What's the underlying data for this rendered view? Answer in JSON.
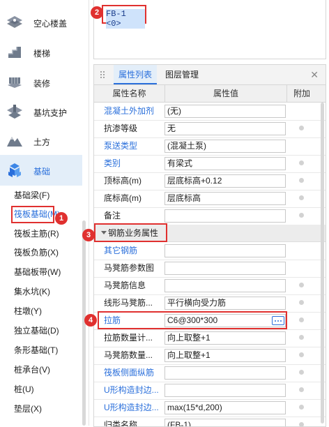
{
  "sidebar": {
    "categories": [
      {
        "label": "空心楼盖",
        "icon": "hollow-floor-icon"
      },
      {
        "label": "楼梯",
        "icon": "stairs-icon"
      },
      {
        "label": "装修",
        "icon": "decoration-icon"
      },
      {
        "label": "基坑支护",
        "icon": "pit-support-icon"
      },
      {
        "label": "土方",
        "icon": "earthwork-icon"
      },
      {
        "label": "基础",
        "icon": "foundation-icon",
        "active": true
      }
    ],
    "sub_items": [
      {
        "label": "基础梁(F)"
      },
      {
        "label": "筏板基础(M)",
        "selected": true
      },
      {
        "label": "筏板主筋(R)"
      },
      {
        "label": "筏板负筋(X)"
      },
      {
        "label": "基础板带(W)"
      },
      {
        "label": "集水坑(K)"
      },
      {
        "label": "柱墩(Y)"
      },
      {
        "label": "独立基础(D)"
      },
      {
        "label": "条形基础(T)"
      },
      {
        "label": "桩承台(V)"
      },
      {
        "label": "桩(U)"
      },
      {
        "label": "垫层(X)"
      }
    ]
  },
  "preview": {
    "code": "FB-1 <0>"
  },
  "panel": {
    "tabs": [
      {
        "label": "属性列表",
        "active": true
      },
      {
        "label": "图层管理"
      }
    ],
    "close_icon": "close-icon",
    "columns": {
      "name": "属性名称",
      "value": "属性值",
      "extra": "附加"
    },
    "rows_top": [
      {
        "name": "混凝土外加剂",
        "value": "(无)",
        "link": true,
        "dot": false
      },
      {
        "name": "抗渗等级",
        "value": "无",
        "link": false,
        "dot": true
      },
      {
        "name": "泵送类型",
        "value": "(混凝土泵)",
        "link": true,
        "dot": false
      },
      {
        "name": "类别",
        "value": "有梁式",
        "link": true,
        "dot": true
      },
      {
        "name": "顶标高(m)",
        "value": "层底标高+0.12",
        "link": false,
        "dot": true
      },
      {
        "name": "底标高(m)",
        "value": "层底标高",
        "link": false,
        "dot": true
      },
      {
        "name": "备注",
        "value": "",
        "link": false,
        "dot": true
      }
    ],
    "group": {
      "label": "钢筋业务属性"
    },
    "rows_bottom": [
      {
        "name": "其它钢筋",
        "value": "",
        "link": true,
        "dot": false
      },
      {
        "name": "马凳筋参数图",
        "value": "",
        "link": false,
        "dot": false
      },
      {
        "name": "马凳筋信息",
        "value": "",
        "link": false,
        "dot": true
      },
      {
        "name": "线形马凳筋...",
        "value": "平行横向受力筋",
        "link": false,
        "dot": true
      },
      {
        "name": "拉筋",
        "value": "C6@300*300",
        "link": true,
        "dot": true,
        "has_button": true
      },
      {
        "name": "拉筋数量计...",
        "value": "向上取整+1",
        "link": false,
        "dot": true
      },
      {
        "name": "马凳筋数量...",
        "value": "向上取整+1",
        "link": false,
        "dot": true
      },
      {
        "name": "筏板侧面纵筋",
        "value": "",
        "link": true,
        "dot": true
      },
      {
        "name": "U形构造封边...",
        "value": "",
        "link": true,
        "dot": true
      },
      {
        "name": "U形构造封边...",
        "value": "max(15*d,200)",
        "link": true,
        "dot": true
      },
      {
        "name": "归类名称",
        "value": "(FB-1)",
        "link": false,
        "dot": true
      }
    ]
  },
  "annotations": [
    {
      "number": "1"
    },
    {
      "number": "2"
    },
    {
      "number": "3"
    },
    {
      "number": "4"
    }
  ],
  "colors": {
    "accent": "#2a6fdb",
    "annotation_red": "#e0302f",
    "active_bg": "#e3eef9"
  }
}
